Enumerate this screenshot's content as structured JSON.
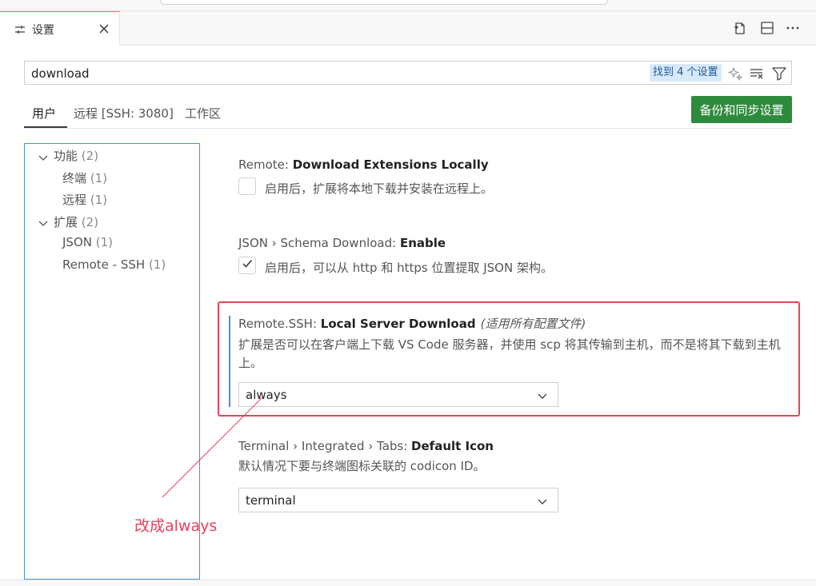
{
  "tab": {
    "label": "设置"
  },
  "search": {
    "value": "download",
    "result_badge": "找到 4 个设置"
  },
  "scopes": {
    "user": "用户",
    "remote": "远程 [SSH: 3080]",
    "workspace": "工作区"
  },
  "sync_button": "备份和同步设置",
  "toc": [
    {
      "label": "功能",
      "count": "(2)"
    },
    {
      "label": "终端",
      "count": "(1)"
    },
    {
      "label": "远程",
      "count": "(1)"
    },
    {
      "label": "扩展",
      "count": "(2)"
    },
    {
      "label": "JSON",
      "count": "(1)"
    },
    {
      "label": "Remote - SSH",
      "count": "(1)"
    }
  ],
  "settings": {
    "s1": {
      "prefix": "Remote: ",
      "name": "Download Extensions Locally",
      "checkbox_label": "启用后，扩展将本地下载并安装在远程上。",
      "checked": false
    },
    "s2": {
      "prefix": "JSON › Schema Download: ",
      "name": "Enable",
      "checkbox_label": "启用后，可以从 http 和 https 位置提取 JSON 架构。",
      "checked": true
    },
    "s3": {
      "prefix": "Remote.SSH: ",
      "name": "Local Server Download",
      "scope_note": "(适用所有配置文件)",
      "description": "扩展是否可以在客户端上下载 VS Code 服务器，并使用 scp 将其传输到主机，而不是将其下载到主机上。",
      "value": "always"
    },
    "s4": {
      "prefix": "Terminal › Integrated › Tabs: ",
      "name": "Default Icon",
      "description": "默认情况下要与终端图标关联的 codicon ID。",
      "value": "terminal"
    }
  },
  "annotation": {
    "text": "改成always"
  },
  "colors": {
    "accent_blue": "#4a90d9",
    "sync_green": "#2e8b3d",
    "annotation_red": "#e8415b",
    "badge_bg": "#d8e9fa"
  },
  "icons": [
    "settings-sliders-icon",
    "close-icon",
    "open-json-icon",
    "split-editor-icon",
    "more-actions-icon",
    "sparkle-icon",
    "clear-filter-icon",
    "filter-icon",
    "chevron-down-icon",
    "check-icon"
  ]
}
